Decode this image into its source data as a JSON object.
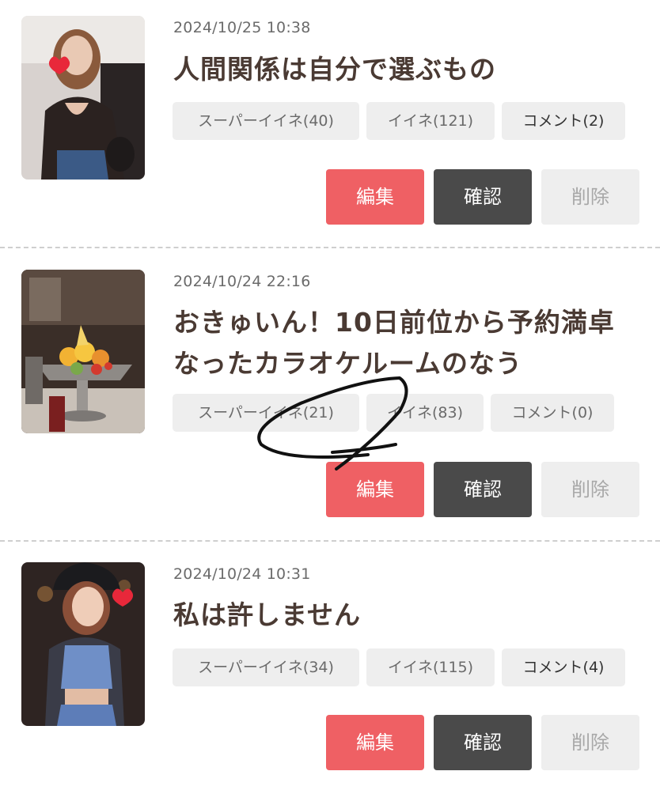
{
  "colors": {
    "edit": "#ef6064",
    "confirm": "#4a4a4a",
    "delete_bg": "#eeeeee",
    "chip_bg": "#eeeeee",
    "title": "#4a3a33"
  },
  "posts": [
    {
      "date": "2024/10/25 10:38",
      "title_lines": [
        "人間関係は自分で選ぶもの"
      ],
      "super_like": "スーパーイイネ(40)",
      "like": "イイネ(121)",
      "comment": "コメント(2)",
      "edit": "編集",
      "confirm": "確認",
      "delete": "削除"
    },
    {
      "date": "2024/10/24 22:16",
      "title_lines": [
        "おきゅいん！10日前位から予約満卓",
        "なったカラオケルームのなう"
      ],
      "super_like": "スーパーイイネ(21)",
      "like": "イイネ(83)",
      "comment": "コメント(0)",
      "edit": "編集",
      "confirm": "確認",
      "delete": "削除"
    },
    {
      "date": "2024/10/24 10:31",
      "title_lines": [
        "私は許しません"
      ],
      "super_like": "スーパーイイネ(34)",
      "like": "イイネ(115)",
      "comment": "コメント(4)",
      "edit": "編集",
      "confirm": "確認",
      "delete": "削除"
    }
  ]
}
